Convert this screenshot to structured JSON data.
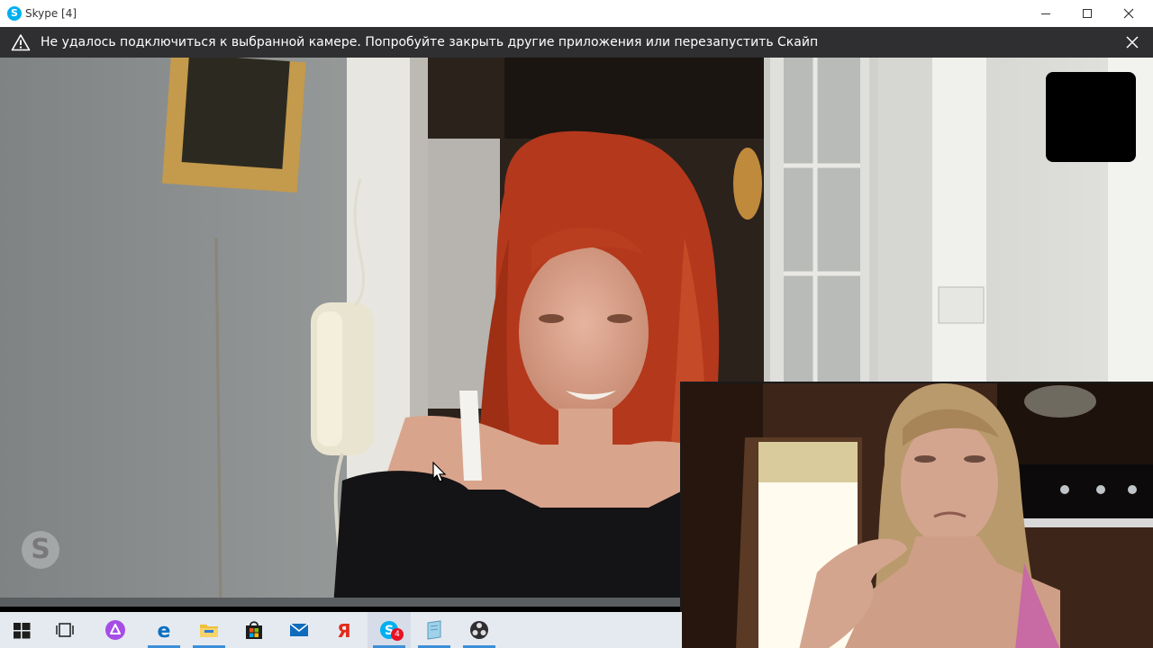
{
  "window": {
    "title": "Skype [4]",
    "minimize_icon": "minimize-icon",
    "maximize_icon": "maximize-icon",
    "close_icon": "close-icon"
  },
  "notification": {
    "icon": "warning-icon",
    "message": "Не удалось подключиться к выбранной камере. Попробуйте закрыть другие приложения или перезапустить Скайп",
    "close_icon": "close-icon"
  },
  "call": {
    "watermark_icon": "skype-watermark-icon",
    "logo_letter": "S"
  },
  "taskbar": {
    "items": [
      {
        "name": "start",
        "icon": "windows-icon"
      },
      {
        "name": "task-view",
        "icon": "task-view-icon"
      },
      {
        "name": "alice",
        "icon": "alice-icon"
      },
      {
        "name": "edge",
        "icon": "edge-icon"
      },
      {
        "name": "file-explorer",
        "icon": "folder-icon"
      },
      {
        "name": "store",
        "icon": "store-icon"
      },
      {
        "name": "mail",
        "icon": "mail-icon"
      },
      {
        "name": "yandex",
        "icon": "yandex-icon"
      },
      {
        "name": "skype",
        "icon": "skype-icon",
        "badge": "4"
      },
      {
        "name": "notepad",
        "icon": "notepad-icon"
      },
      {
        "name": "obs",
        "icon": "obs-icon"
      }
    ]
  },
  "colors": {
    "titlebar_bg": "#ffffff",
    "notification_bg": "#2f2f31",
    "taskbar_bg": "#e5eaf1",
    "accent": "#00aff0",
    "badge": "#e81123"
  }
}
